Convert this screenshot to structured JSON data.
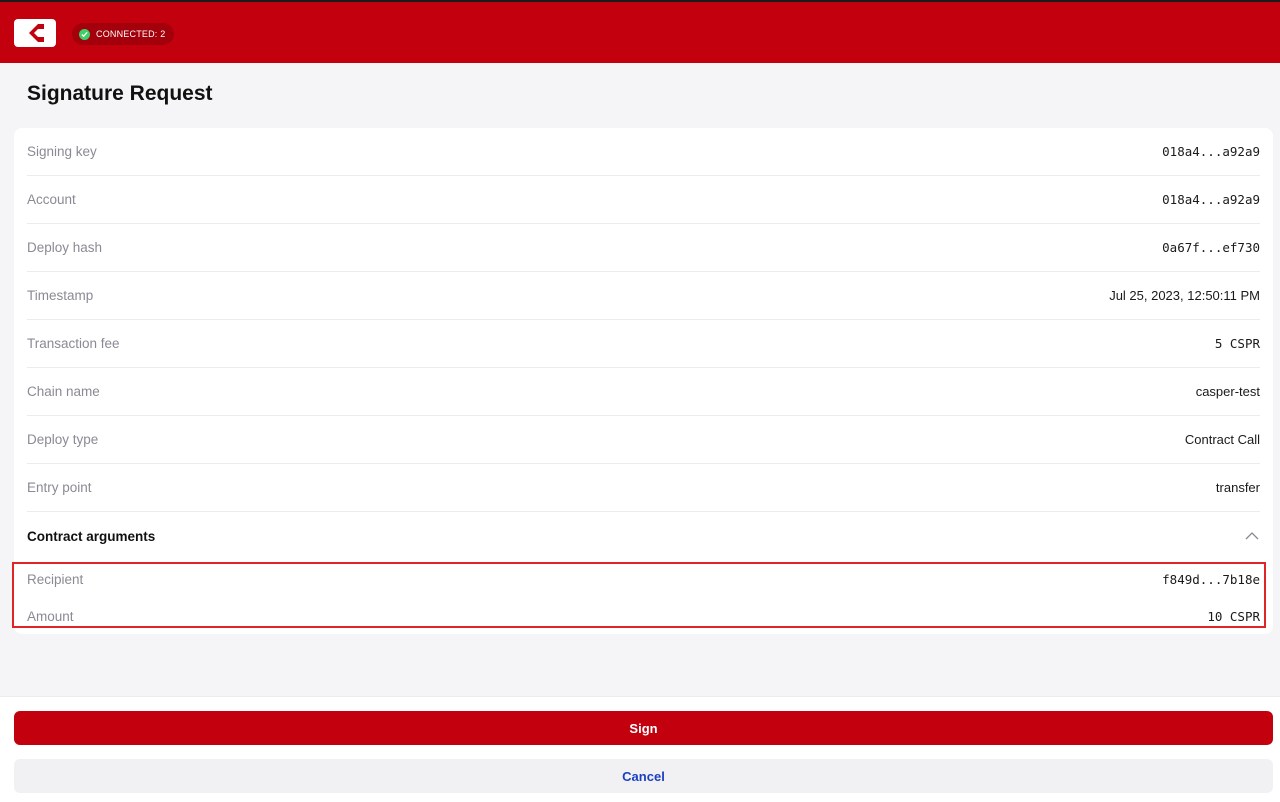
{
  "header": {
    "logo_icon": "casper-logo-icon",
    "status_label": "CONNECTED: 2",
    "status_color": "#3ccf6a",
    "brand_color": "#c2000e"
  },
  "page": {
    "title": "Signature Request"
  },
  "details": [
    {
      "label": "Signing key",
      "value": "018a4...a92a9",
      "mono": true
    },
    {
      "label": "Account",
      "value": "018a4...a92a9",
      "mono": true
    },
    {
      "label": "Deploy hash",
      "value": "0a67f...ef730",
      "mono": true
    },
    {
      "label": "Timestamp",
      "value": "Jul 25, 2023, 12:50:11 PM",
      "mono": false
    },
    {
      "label": "Transaction fee",
      "value": "5 CSPR",
      "mono": true
    },
    {
      "label": "Chain name",
      "value": "casper-test",
      "mono": false
    },
    {
      "label": "Deploy type",
      "value": "Contract Call",
      "mono": false
    },
    {
      "label": "Entry point",
      "value": "transfer",
      "mono": false
    }
  ],
  "contract_arguments": {
    "title": "Contract arguments",
    "toggle_icon": "chevron-up-icon",
    "items": [
      {
        "label": "Recipient",
        "value": "f849d...7b18e"
      },
      {
        "label": "Amount",
        "value": "10 CSPR"
      }
    ]
  },
  "actions": {
    "sign_label": "Sign",
    "cancel_label": "Cancel"
  }
}
